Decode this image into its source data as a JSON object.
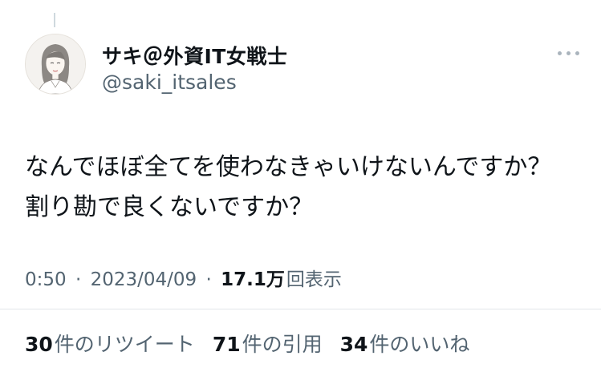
{
  "author": {
    "display_name": "サキ＠外資IT女戦士",
    "handle": "@saki_itsales"
  },
  "tweet": {
    "lines": [
      "なんでほぼ全てを使わなきゃいけないんですか？",
      "割り勘で良くないですか？"
    ]
  },
  "meta": {
    "time": "0:50",
    "separator": "·",
    "date": "2023/04/09",
    "views_count": "17.1万",
    "views_label": "回表示"
  },
  "stats": {
    "retweets_count": "30",
    "retweets_label": "件のリツイート",
    "quotes_count": "71",
    "quotes_label": "件の引用",
    "likes_count": "34",
    "likes_label": "件のいいね"
  },
  "icons": {
    "avatar": "avatar-illustration",
    "more": "more-options-icon"
  }
}
